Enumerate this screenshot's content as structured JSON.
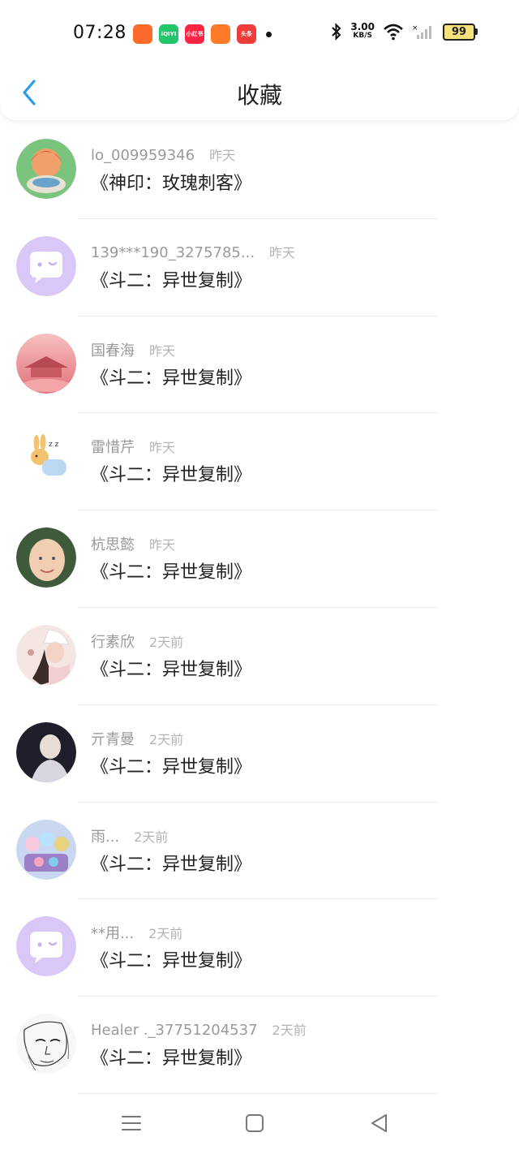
{
  "status_bar": {
    "time": "07:28",
    "net_speed": "3.00",
    "net_unit": "KB/S",
    "battery": "99",
    "app_icons": [
      {
        "name": "app-icon-1",
        "label": "",
        "color": "#ff6a2b"
      },
      {
        "name": "app-icon-iqiyi",
        "label": "iQIYI",
        "color": "#23c56b"
      },
      {
        "name": "app-icon-xiaohongshu",
        "label": "小红书",
        "color": "#ff2442"
      },
      {
        "name": "app-icon-4",
        "label": "",
        "color": "#ff7b2a"
      },
      {
        "name": "app-icon-toutiao",
        "label": "头条",
        "color": "#f23b3b"
      }
    ]
  },
  "header": {
    "title": "收藏"
  },
  "items": [
    {
      "name": "lo_009959346",
      "date": "昨天",
      "book": "《神印：玫瑰刺客》",
      "avatar": "cartoon"
    },
    {
      "name": "139***190_3275785...",
      "date": "昨天",
      "book": "《斗二：异世复制》",
      "avatar": "default"
    },
    {
      "name": "国春海",
      "date": "昨天",
      "book": "《斗二：异世复制》",
      "avatar": "pink-scene"
    },
    {
      "name": "雷惜芹",
      "date": "昨天",
      "book": "《斗二：异世复制》",
      "avatar": "bunny"
    },
    {
      "name": "杭思懿",
      "date": "昨天",
      "book": "《斗二：异世复制》",
      "avatar": "boy"
    },
    {
      "name": "行素欣",
      "date": "2天前",
      "book": "《斗二：异世复制》",
      "avatar": "girl"
    },
    {
      "name": "亓青曼",
      "date": "2天前",
      "book": "《斗二：异世复制》",
      "avatar": "dark"
    },
    {
      "name": "雨...",
      "date": "2天前",
      "book": "《斗二：异世复制》",
      "avatar": "anime"
    },
    {
      "name": "**用...",
      "date": "2天前",
      "book": "《斗二：异世复制》",
      "avatar": "default"
    },
    {
      "name": "Healer ._37751204537",
      "date": "2天前",
      "book": "《斗二：异世复制》",
      "avatar": "sketch"
    }
  ],
  "icons": {
    "back": "chevron-left-icon",
    "menu": "menu-icon",
    "home": "home-square-icon",
    "back_nav": "back-triangle-icon"
  }
}
